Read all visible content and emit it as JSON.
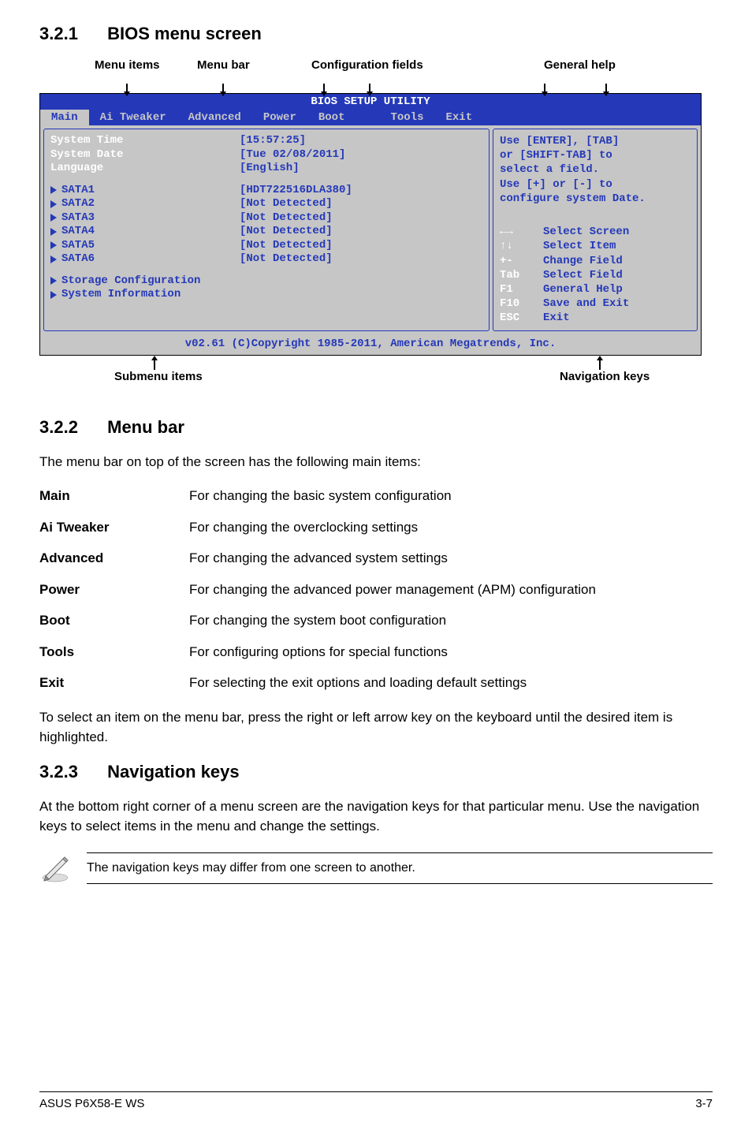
{
  "section1": {
    "num": "3.2.1",
    "title": "BIOS menu screen"
  },
  "topLabels": {
    "menuItems": "Menu items",
    "menuBar": "Menu bar",
    "configFields": "Configuration fields",
    "generalHelp": "General help"
  },
  "bios": {
    "title": "BIOS SETUP UTILITY",
    "menubar": [
      "Main",
      "Ai Tweaker",
      "Advanced",
      "Power",
      "Boot",
      "Tools",
      "Exit"
    ],
    "left": {
      "systemTime": {
        "label": "System Time",
        "value": "[15:57:25]"
      },
      "systemDate": {
        "label": "System Date",
        "value": "[Tue 02/08/2011]"
      },
      "language": {
        "label": "Language",
        "value": "[English]"
      },
      "sata": [
        {
          "label": "SATA1",
          "value": "[HDT722516DLA380]"
        },
        {
          "label": "SATA2",
          "value": "[Not Detected]"
        },
        {
          "label": "SATA3",
          "value": "[Not Detected]"
        },
        {
          "label": "SATA4",
          "value": "[Not Detected]"
        },
        {
          "label": "SATA5",
          "value": "[Not Detected]"
        },
        {
          "label": "SATA6",
          "value": "[Not Detected]"
        }
      ],
      "storageCfg": "Storage Configuration",
      "sysInfo": "System Information"
    },
    "right": {
      "help": [
        "Use [ENTER], [TAB]",
        "or [SHIFT-TAB] to",
        "select a field.",
        "",
        "Use [+] or [-] to",
        "configure system Date."
      ],
      "nav": [
        {
          "k": "←→",
          "d": "Select Screen"
        },
        {
          "k": "↑↓",
          "d": "Select Item"
        },
        {
          "k": "+-",
          "d": "Change Field"
        },
        {
          "k": "Tab",
          "d": "Select Field"
        },
        {
          "k": "F1",
          "d": "General Help"
        },
        {
          "k": "F10",
          "d": "Save and Exit"
        },
        {
          "k": "ESC",
          "d": "Exit"
        }
      ]
    },
    "footer": "v02.61 (C)Copyright 1985-2011, American Megatrends, Inc."
  },
  "bottomLabels": {
    "submenu": "Submenu items",
    "navkeys": "Navigation keys"
  },
  "section2": {
    "num": "3.2.2",
    "title": "Menu bar"
  },
  "p_menubar_intro": "The menu bar on top of the screen has the following main items:",
  "table": [
    {
      "label": "Main",
      "desc": "For changing the basic system configuration"
    },
    {
      "label": "Ai Tweaker",
      "desc": "For changing the overclocking settings"
    },
    {
      "label": "Advanced",
      "desc": "For changing the advanced system settings"
    },
    {
      "label": "Power",
      "desc": "For changing the advanced power management (APM) configuration"
    },
    {
      "label": "Boot",
      "desc": "For changing the system boot configuration"
    },
    {
      "label": "Tools",
      "desc": "For configuring options for special functions"
    },
    {
      "label": "Exit",
      "desc": "For selecting the exit options and loading default settings"
    }
  ],
  "p_select_item": "To select an item on the menu bar, press the right or left arrow key on the keyboard until the desired item is highlighted.",
  "section3": {
    "num": "3.2.3",
    "title": "Navigation keys"
  },
  "p_navkeys": "At the bottom right corner of a menu screen are the navigation keys for that particular menu. Use the navigation keys to select items in the menu and change the settings.",
  "note": "The navigation keys may differ from one screen to another.",
  "footer": {
    "left": "ASUS P6X58-E WS",
    "right": "3-7"
  }
}
